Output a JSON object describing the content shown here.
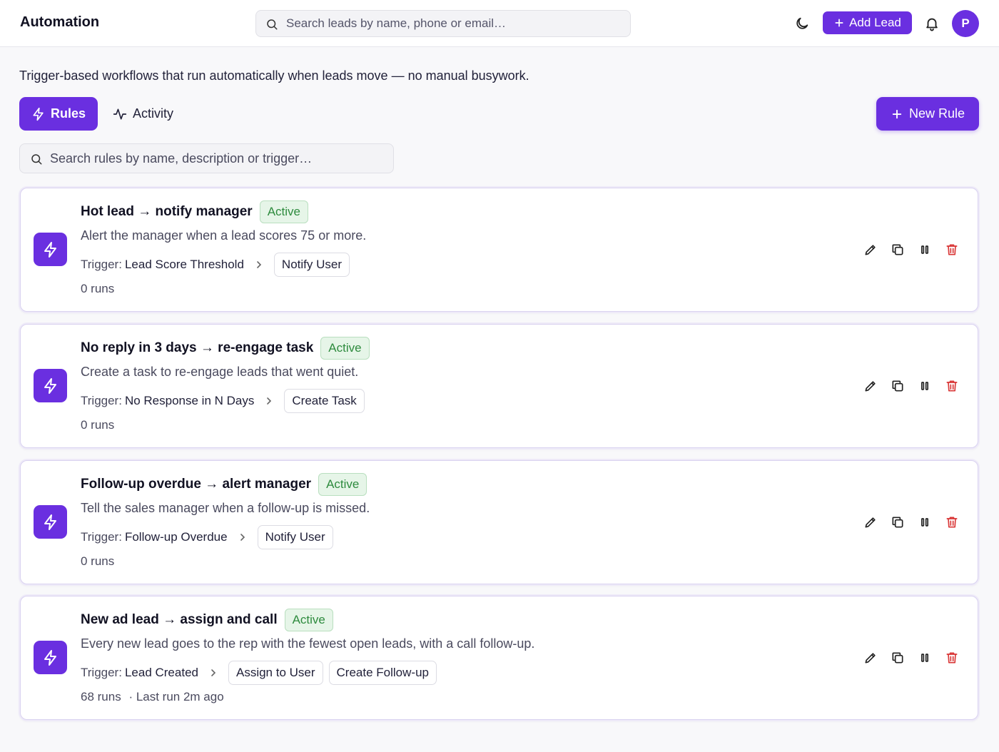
{
  "header": {
    "app_title": "Automation",
    "search_placeholder": "Search leads by name, phone or email…",
    "add_lead_label": "Add Lead",
    "avatar_initial": "P"
  },
  "intro_text": "Trigger-based workflows that run automatically when leads move — no manual busywork.",
  "tabs": [
    {
      "label": "Rules",
      "active": true
    },
    {
      "label": "Activity",
      "active": false
    }
  ],
  "new_rule_label": "New Rule",
  "rule_search_placeholder": "Search rules by name, description or trigger…",
  "trigger_prefix": "Trigger:",
  "colors": {
    "accent": "#6a2fe0",
    "active_green": "#2e8b3e",
    "delete_red": "#d93636"
  },
  "rules": [
    {
      "title": "Hot lead → notify manager",
      "status": "Active",
      "description": "Alert the manager when a lead scores 75 or more.",
      "trigger": "Lead Score Threshold",
      "actions": [
        "Notify User"
      ],
      "runs": "0 runs",
      "last_run": ""
    },
    {
      "title": "No reply in 3 days → re-engage task",
      "status": "Active",
      "description": "Create a task to re-engage leads that went quiet.",
      "trigger": "No Response in N Days",
      "actions": [
        "Create Task"
      ],
      "runs": "0 runs",
      "last_run": ""
    },
    {
      "title": "Follow-up overdue → alert manager",
      "status": "Active",
      "description": "Tell the sales manager when a follow-up is missed.",
      "trigger": "Follow-up Overdue",
      "actions": [
        "Notify User"
      ],
      "runs": "0 runs",
      "last_run": ""
    },
    {
      "title": "New ad lead → assign and call",
      "status": "Active",
      "description": "Every new lead goes to the rep with the fewest open leads, with a call follow-up.",
      "trigger": "Lead Created",
      "actions": [
        "Assign to User",
        "Create Follow-up"
      ],
      "runs": "68 runs",
      "last_run": "· Last run 2m ago"
    }
  ]
}
